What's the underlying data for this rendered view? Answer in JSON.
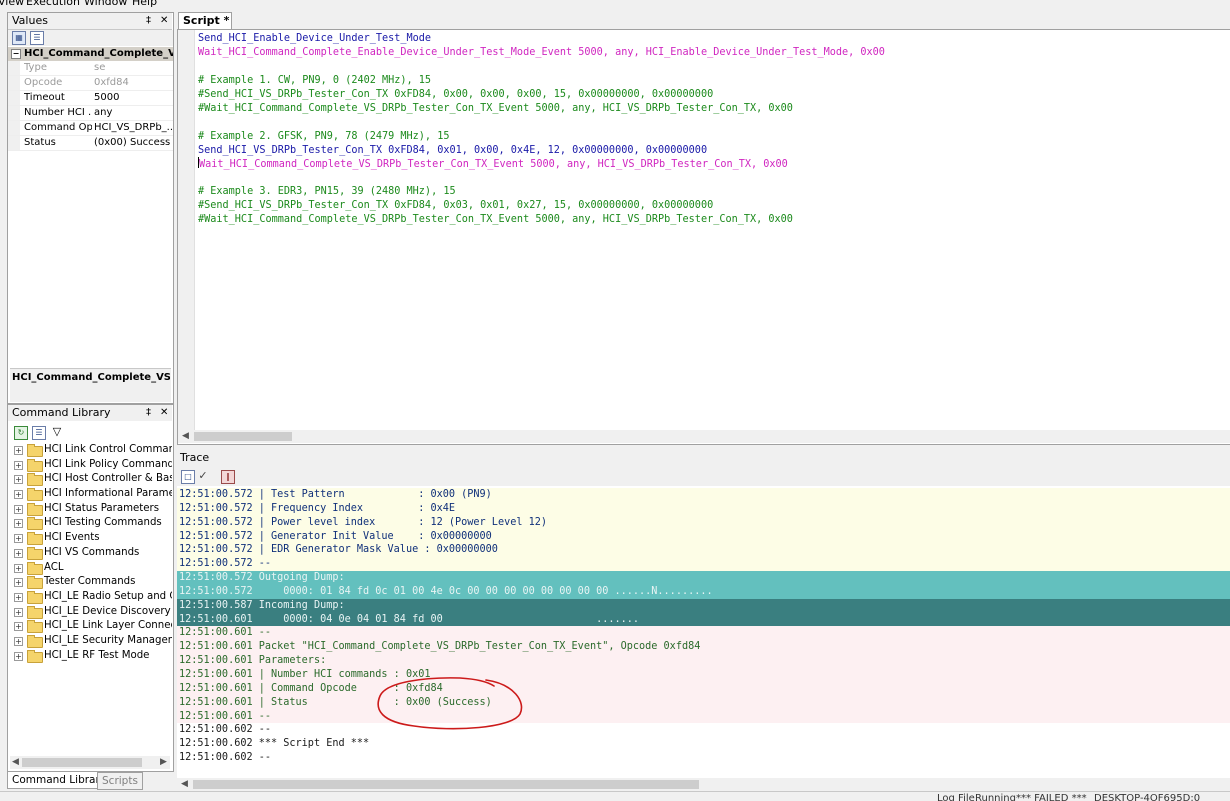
{
  "menu": {
    "items": [
      "View",
      "Execution",
      "Window",
      "Help"
    ]
  },
  "values_panel": {
    "title": "Values",
    "pin": "‡",
    "close": "✕",
    "group": "HCI_Command_Complete_V...",
    "rows": [
      {
        "key": "Type",
        "value": "se",
        "readonly": true
      },
      {
        "key": "Opcode",
        "value": "0xfd84",
        "readonly": true
      },
      {
        "key": "Timeout",
        "value": "5000",
        "readonly": false
      },
      {
        "key": "Number HCI ...",
        "value": "any",
        "readonly": false
      },
      {
        "key": "Command Op...",
        "value": "HCI_VS_DRPb_...",
        "readonly": false
      },
      {
        "key": "Status",
        "value": "(0x00) Success",
        "readonly": false
      }
    ],
    "description_title": "HCI_Command_Complete_VS_DR"
  },
  "command_library": {
    "title": "Command Library",
    "items": [
      "HCI Link Control Commands",
      "HCI Link Policy Commands",
      "HCI Host Controller & Baseband",
      "HCI Informational Parameters",
      "HCI Status Parameters",
      "HCI Testing Commands",
      "HCI Events",
      "HCI VS Commands",
      "ACL",
      "Tester Commands",
      "HCI_LE Radio Setup and Configuration",
      "HCI_LE Device Discovery",
      "HCI_LE Link Layer Connection",
      "HCI_LE Security Management",
      "HCI_LE RF Test Mode"
    ]
  },
  "bottom_tabs": {
    "command_library": "Command Library",
    "scripts": "Scripts"
  },
  "script": {
    "tab_label": "Script *",
    "lines": [
      {
        "text": "Send_HCI_Enable_Device_Under_Test_Mode",
        "kind": "send"
      },
      {
        "text": "Wait_HCI_Command_Complete_Enable_Device_Under_Test_Mode_Event 5000, any, HCI_Enable_Device_Under_Test_Mode, 0x00",
        "kind": "wait"
      },
      {
        "text": "",
        "kind": "blank"
      },
      {
        "text": "# Example 1. CW, PN9, 0 (2402 MHz), 15",
        "kind": "comment"
      },
      {
        "text": "#Send_HCI_VS_DRPb_Tester_Con_TX 0xFD84, 0x00, 0x00, 0x00, 15, 0x00000000, 0x00000000",
        "kind": "comment"
      },
      {
        "text": "#Wait_HCI_Command_Complete_VS_DRPb_Tester_Con_TX_Event 5000, any, HCI_VS_DRPb_Tester_Con_TX, 0x00",
        "kind": "comment"
      },
      {
        "text": "",
        "kind": "blank"
      },
      {
        "text": "# Example 2. GFSK, PN9, 78 (2479 MHz), 15",
        "kind": "comment"
      },
      {
        "text": "Send_HCI_VS_DRPb_Tester_Con_TX 0xFD84, 0x01, 0x00, 0x4E, 12, 0x00000000, 0x00000000",
        "kind": "send"
      },
      {
        "text": "Wait_HCI_Command_Complete_VS_DRPb_Tester_Con_TX_Event 5000, any, HCI_VS_DRPb_Tester_Con_TX, 0x00",
        "kind": "wait",
        "caret": true
      },
      {
        "text": "",
        "kind": "blank"
      },
      {
        "text": "# Example 3. EDR3, PN15, 39 (2480 MHz), 15",
        "kind": "comment"
      },
      {
        "text": "#Send_HCI_VS_DRPb_Tester_Con_TX 0xFD84, 0x03, 0x01, 0x27, 15, 0x00000000, 0x00000000",
        "kind": "comment"
      },
      {
        "text": "#Wait_HCI_Command_Complete_VS_DRPb_Tester_Con_TX_Event 5000, any, HCI_VS_DRPb_Tester_Con_TX, 0x00",
        "kind": "comment"
      }
    ]
  },
  "trace": {
    "title": "Trace",
    "lines": [
      {
        "time": "12:51:00.572",
        "text": " | Test Pattern            : 0x00 (PN9)",
        "bg": "yellow"
      },
      {
        "time": "12:51:00.572",
        "text": " | Frequency Index         : 0x4E",
        "bg": "yellow"
      },
      {
        "time": "12:51:00.572",
        "text": " | Power level index       : 12 (Power Level 12)",
        "bg": "yellow"
      },
      {
        "time": "12:51:00.572",
        "text": " | Generator Init Value    : 0x00000000",
        "bg": "yellow"
      },
      {
        "time": "12:51:00.572",
        "text": " | EDR Generator Mask Value : 0x00000000",
        "bg": "yellow"
      },
      {
        "time": "12:51:00.572",
        "text": " --",
        "bg": "yellow"
      },
      {
        "time": "12:51:00.572",
        "text": " Outgoing Dump:",
        "bg": "teal"
      },
      {
        "time": "12:51:00.572",
        "text": "     0000: 01 84 fd 0c 01 00 4e 0c 00 00 00 00 00 00 00 00 ......N.........",
        "bg": "teal"
      },
      {
        "time": "12:51:00.587",
        "text": " Incoming Dump:",
        "bg": "dteal"
      },
      {
        "time": "12:51:00.601",
        "text": "     0000: 04 0e 04 01 84 fd 00                         .......",
        "bg": "dteal"
      },
      {
        "time": "12:51:00.601",
        "text": " --",
        "bg": "pink"
      },
      {
        "time": "12:51:00.601",
        "text": " Packet \"HCI_Command_Complete_VS_DRPb_Tester_Con_TX_Event\", Opcode 0xfd84",
        "bg": "pink"
      },
      {
        "time": "12:51:00.601",
        "text": " Parameters:",
        "bg": "pink"
      },
      {
        "time": "12:51:00.601",
        "text": " | Number HCI commands : 0x01",
        "bg": "pink"
      },
      {
        "time": "12:51:00.601",
        "text": " | Command Opcode      : 0xfd84",
        "bg": "pink"
      },
      {
        "time": "12:51:00.601",
        "text": " | Status              : 0x00 (Success)",
        "bg": "pink"
      },
      {
        "time": "12:51:00.601",
        "text": " --",
        "bg": "pink"
      },
      {
        "time": "12:51:00.602",
        "text": " --",
        "bg": "white"
      },
      {
        "time": "12:51:00.602",
        "text": " *** Script End ***",
        "bg": "white"
      },
      {
        "time": "12:51:00.602",
        "text": " --",
        "bg": "white"
      }
    ]
  },
  "statusbar": {
    "log_file": "Log File",
    "state": "Running",
    "result": "*** FAILED ***",
    "host": "DESKTOP-4OF695D:0"
  },
  "colors": {
    "send": "#1a1aa8",
    "wait": "#d026c0",
    "comment": "#1c8a1c",
    "trace_teal": "#63c0be",
    "trace_dark_teal": "#3a7f80",
    "annotation": "#cc1a1a"
  }
}
